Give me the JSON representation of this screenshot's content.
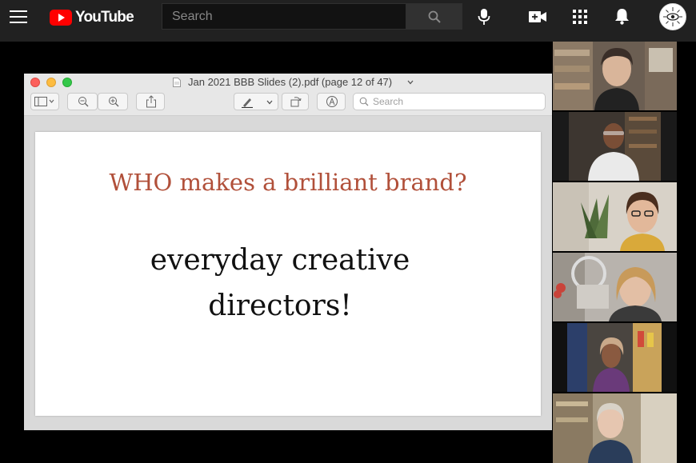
{
  "youtube": {
    "logo_text": "YouTube",
    "search_placeholder": "Search",
    "icons": [
      "menu-icon",
      "youtube-logo-icon",
      "search-icon",
      "mic-icon",
      "create-video-icon",
      "apps-icon",
      "bell-icon",
      "channel-avatar"
    ]
  },
  "preview_window": {
    "title": "Jan 2021 BBB Slides (2).pdf (page 12 of 47)",
    "search_placeholder": "Search",
    "toolbar_icons": [
      "sidebar-icon",
      "zoom-out-icon",
      "zoom-in-icon",
      "share-icon",
      "markup-pen-icon",
      "rotate-icon",
      "annotate-icon"
    ]
  },
  "slide": {
    "heading": "WHO makes a brilliant brand?",
    "body_line1": "everyday creative",
    "body_line2": "directors!"
  },
  "participants": [
    {
      "tile": "participant-1"
    },
    {
      "tile": "participant-2"
    },
    {
      "tile": "participant-3"
    },
    {
      "tile": "participant-4"
    },
    {
      "tile": "participant-5"
    },
    {
      "tile": "participant-6"
    }
  ],
  "colors": {
    "yt_bar": "#212121",
    "yt_red": "#ff0000",
    "slide_heading": "#b1503a"
  }
}
